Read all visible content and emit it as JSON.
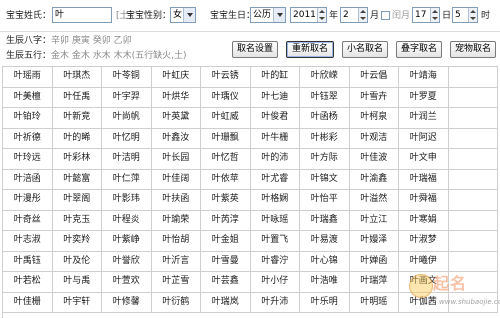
{
  "form": {
    "surname_label": "宝宝姓氏：",
    "surname_value": "叶",
    "surname_hint": "[土]",
    "gender_label": "宝宝性别：",
    "gender_value": "女",
    "birthday_label": "宝宝生日：",
    "calendar_value": "公历",
    "year_value": "2011",
    "year_unit": "年",
    "month_value": "2",
    "month_unit": "月",
    "leap_label": "闰月",
    "day_value": "17",
    "day_unit": "日",
    "hour_value": "5",
    "hour_unit": "时"
  },
  "info": {
    "bazi_label": "生辰八字：",
    "bazi_value": "辛卯 庚寅 癸卯 乙卯",
    "wuxing_label": "生辰五行：",
    "wuxing_value": "金木 金木 水木 木木(五行缺火,土)"
  },
  "buttons": [
    {
      "label": "取名设置"
    },
    {
      "label": "重新取名"
    },
    {
      "label": "小名取名"
    },
    {
      "label": "叠字取名"
    },
    {
      "label": "宠物取名"
    }
  ],
  "names": [
    [
      "叶瑶雨",
      "叶琪杰",
      "叶苓铜",
      "叶虹庆",
      "叶云锈",
      "叶的缸",
      "叶欣嵘",
      "叶云倡",
      "叶靖海"
    ],
    [
      "叶美檀",
      "叶任禹",
      "叶宇羿",
      "叶烘华",
      "叶瑀仪",
      "叶七迪",
      "叶钰翠",
      "叶雪卉",
      "叶罗夏"
    ],
    [
      "叶铂玲",
      "叶新竞",
      "叶尚帆",
      "叶英黛",
      "叶虹威",
      "叶俊君",
      "叶函杨",
      "叶柯泉",
      "叶润兰"
    ],
    [
      "叶祈德",
      "叶的晞",
      "叶忆明",
      "叶鑫汝",
      "叶珊飘",
      "叶牛栅",
      "叶彬彩",
      "叶观洁",
      "叶阿迟"
    ],
    [
      "叶玲远",
      "叶彩林",
      "叶洁明",
      "叶长园",
      "叶忆哲",
      "叶的沛",
      "叶方际",
      "叶佳波",
      "叶文申"
    ],
    [
      "叶涪函",
      "叶懿富",
      "叶仁萍",
      "叶佳阔",
      "叶依苹",
      "叶尤睿",
      "叶锦文",
      "叶渝鑫",
      "叶瑞福"
    ],
    [
      "叶漫彤",
      "叶翠阁",
      "叶影玮",
      "叶扶函",
      "叶紫英",
      "叶格娴",
      "叶怡平",
      "叶溢然",
      "叶舜福"
    ],
    [
      "叶奇丝",
      "叶克玉",
      "叶程炎",
      "叶瑜荣",
      "叶芮淳",
      "叶咏瑶",
      "叶瑞鑫",
      "叶立江",
      "叶寒娟"
    ],
    [
      "叶志淑",
      "叶奕羚",
      "叶紫峥",
      "叶怡胡",
      "叶金姐",
      "叶置飞",
      "叶易渡",
      "叶嫚泽",
      "叶淑梦"
    ],
    [
      "叶禹钰",
      "叶及伦",
      "叶誉欣",
      "叶沂言",
      "叶雪曼",
      "叶睿泞",
      "叶心锦",
      "叶婵函",
      "叶曦伊"
    ],
    [
      "叶若松",
      "叶与禹",
      "叶萱欢",
      "叶芷雪",
      "叶芸鑫",
      "叶小仔",
      "叶浩唯",
      "叶瑞萍",
      "叶画文"
    ],
    [
      "叶佳栅",
      "叶宇轩",
      "叶修馨",
      "叶衍鹤",
      "叶瑞岚",
      "叶升沛",
      "叶乐明",
      "叶明瑶",
      "叶伽茜"
    ]
  ],
  "watermark": {
    "logo_text": "起名",
    "url": "www.shubaojie.com"
  },
  "colors": {
    "grid_line": "#cfcfcf",
    "input_border": "#7f9db9",
    "muted_text": "#8a8a8a"
  }
}
